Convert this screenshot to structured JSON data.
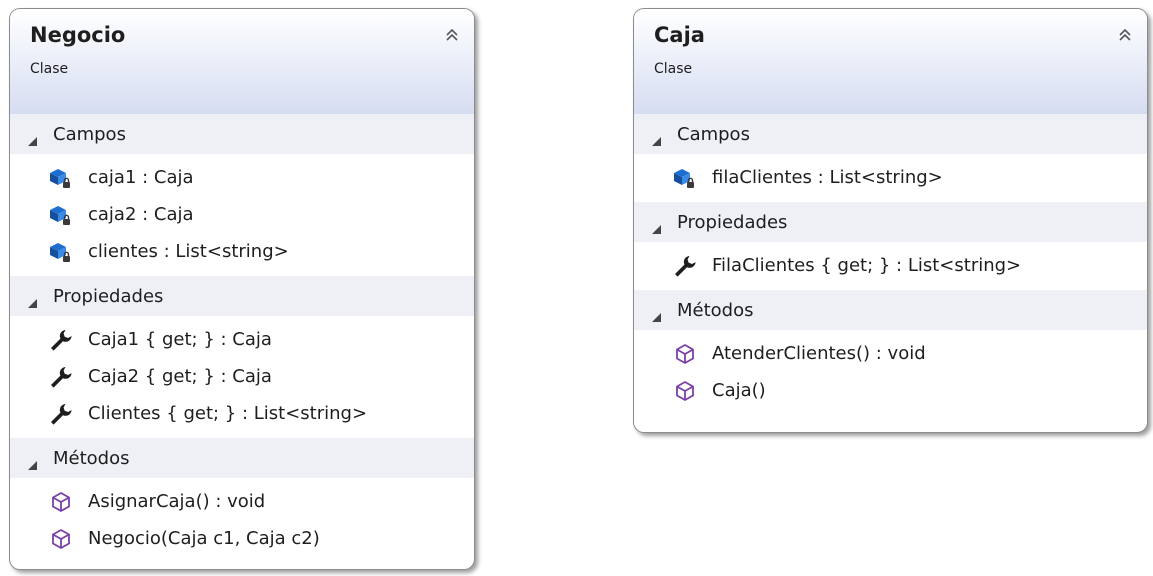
{
  "classes": [
    {
      "id": "negocio",
      "name": "Negocio",
      "kind": "Clase",
      "sections": [
        {
          "title": "Campos",
          "member_icon": "private-field-icon",
          "members": [
            "caja1 : Caja",
            "caja2 : Caja",
            "clientes : List<string>"
          ]
        },
        {
          "title": "Propiedades",
          "member_icon": "property-wrench-icon",
          "members": [
            "Caja1 { get; } : Caja",
            "Caja2 { get; } : Caja",
            "Clientes { get; } : List<string>"
          ]
        },
        {
          "title": "Métodos",
          "member_icon": "method-cube-icon",
          "members": [
            "AsignarCaja() : void",
            "Negocio(Caja c1, Caja c2)"
          ]
        }
      ]
    },
    {
      "id": "caja",
      "name": "Caja",
      "kind": "Clase",
      "sections": [
        {
          "title": "Campos",
          "member_icon": "private-field-icon",
          "members": [
            "filaClientes : List<string>"
          ]
        },
        {
          "title": "Propiedades",
          "member_icon": "property-wrench-icon",
          "members": [
            "FilaClientes { get; } : List<string>"
          ]
        },
        {
          "title": "Métodos",
          "member_icon": "method-cube-icon",
          "members": [
            "AtenderClientes() : void",
            "Caja()"
          ]
        }
      ]
    }
  ],
  "colors": {
    "field_icon": "#1e6ed2",
    "wrench_icon": "#1e1e1e",
    "method_icon": "#7a3fa8",
    "header_gradient_end": "#d6ddf1",
    "section_bg": "#eef0f5",
    "border": "#8c8c8c"
  }
}
